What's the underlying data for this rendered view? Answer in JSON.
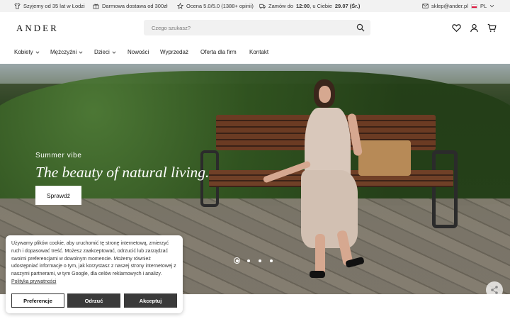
{
  "topbar": {
    "item1": "Szyjemy od 35 lat w Łodzi",
    "item2": "Darmowa dostawa od 300zł",
    "item3": "Ocena 5.0/5.0 (1388+ opinii)",
    "item4_prefix": "Zamów do",
    "item4_time": "12:00",
    "item4_mid": ", u Ciebie",
    "item4_date": "29.07 (Śr.)",
    "email": "sklep@ander.pl",
    "lang": "PL"
  },
  "header": {
    "logo": "ANDER",
    "search_placeholder": "Czego szukasz?"
  },
  "nav": {
    "items": [
      "Kobiety",
      "Mężczyźni",
      "Dzieci",
      "Nowości",
      "Wyprzedaż",
      "Oferta dla firm",
      "Kontakt"
    ]
  },
  "hero": {
    "kicker": "Summer vibe",
    "title": "The beauty of natural living.",
    "button": "Sprawdź",
    "slides": 4,
    "active_slide": 1
  },
  "cookie": {
    "text": "Używamy plików cookie, aby uruchomić tę stronę internetową, zmierzyć ruch i dopasować treść. Możesz zaakceptować, odrzucić lub zarządzać swoimi preferencjami w dowolnym momencie. Możemy również udostępniać informacje o tym, jak korzystasz z naszej strony internetowej z naszymi partnerami, w tym Google, dla celów reklamowych i analizy.",
    "link": "Polityka prywatności",
    "btn_preferences": "Preferencje",
    "btn_reject": "Odrzuć",
    "btn_accept": "Akceptuj"
  }
}
